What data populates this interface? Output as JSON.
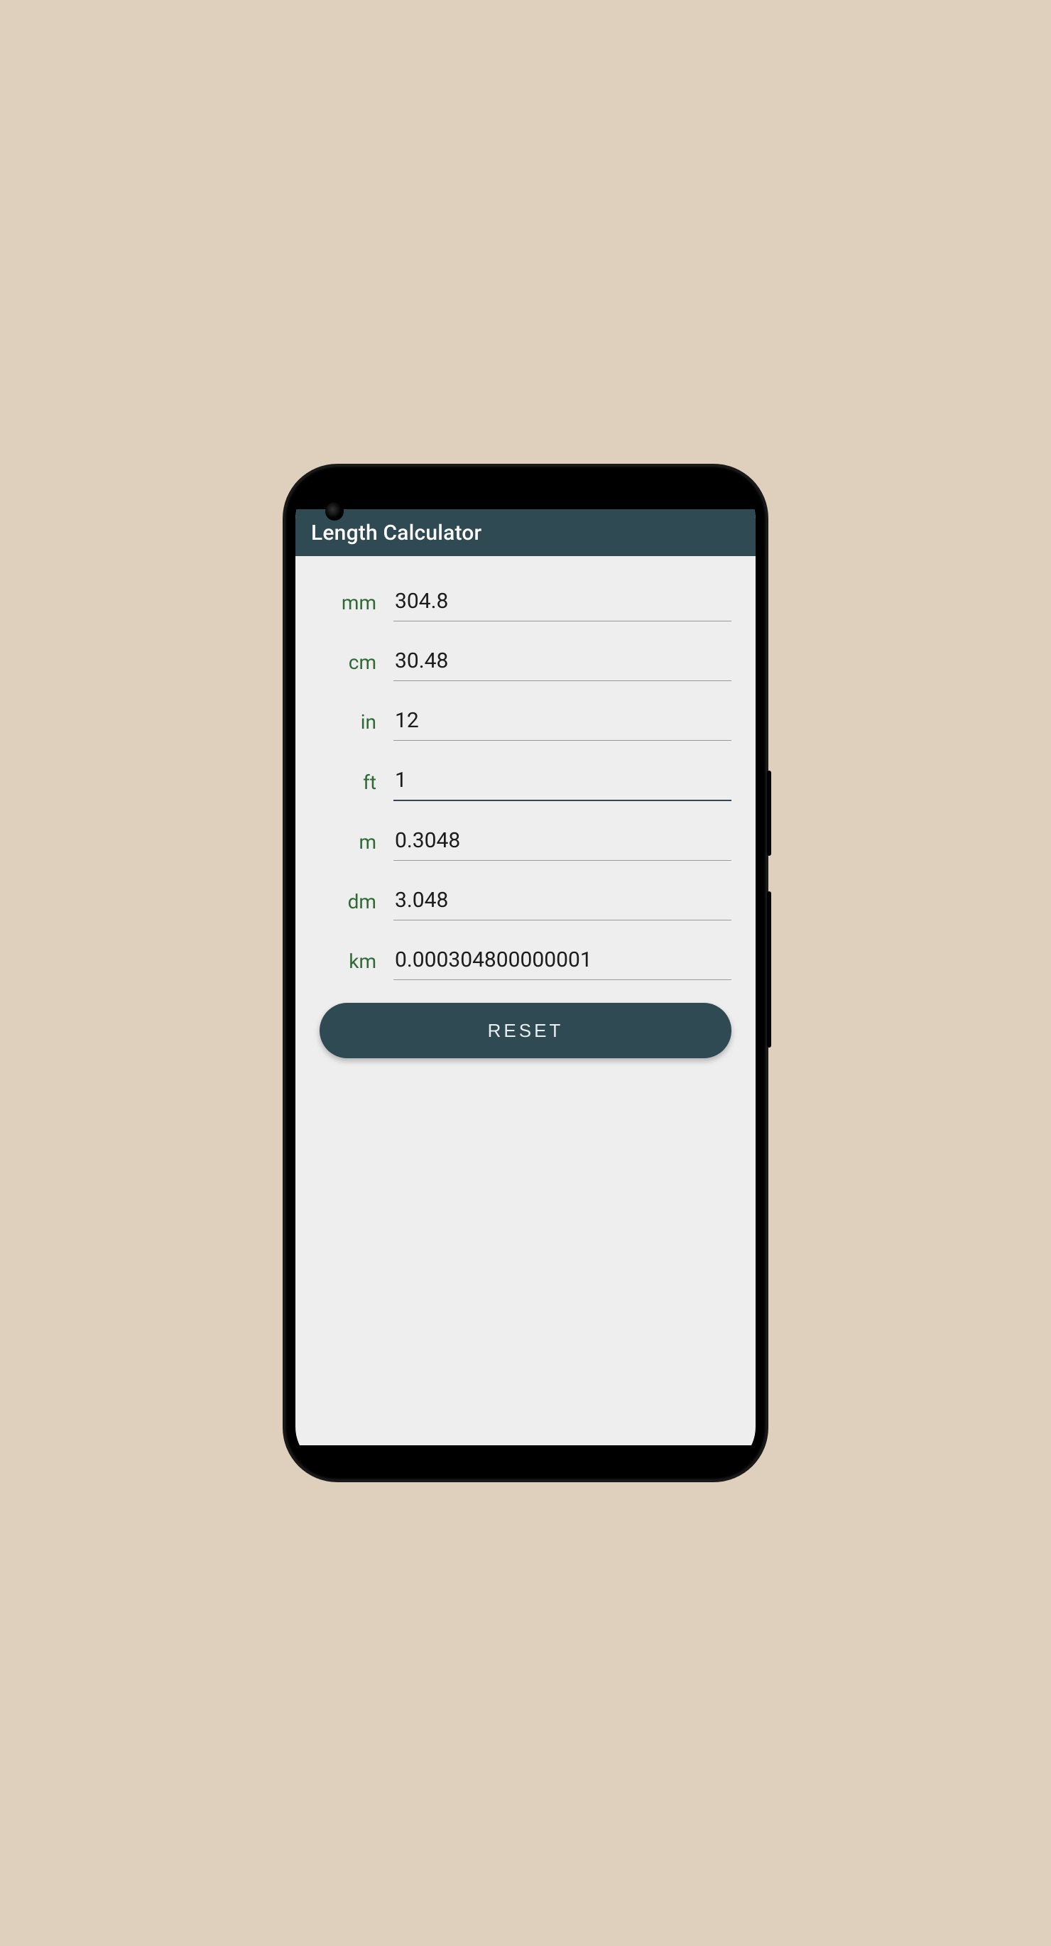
{
  "appbar": {
    "title": "Length Calculator"
  },
  "units": {
    "mm": {
      "label": "mm",
      "value": "304.8"
    },
    "cm": {
      "label": "cm",
      "value": "30.48"
    },
    "in": {
      "label": "in",
      "value": "12"
    },
    "ft": {
      "label": "ft",
      "value": "1"
    },
    "m": {
      "label": "m",
      "value": "0.3048"
    },
    "dm": {
      "label": "dm",
      "value": "3.048"
    },
    "km": {
      "label": "km",
      "value": "0.000304800000001"
    }
  },
  "buttons": {
    "reset": "RESET"
  },
  "colors": {
    "accent": "#2f4a53",
    "labelGreen": "#2e6b34",
    "bg": "#eeeeee"
  }
}
